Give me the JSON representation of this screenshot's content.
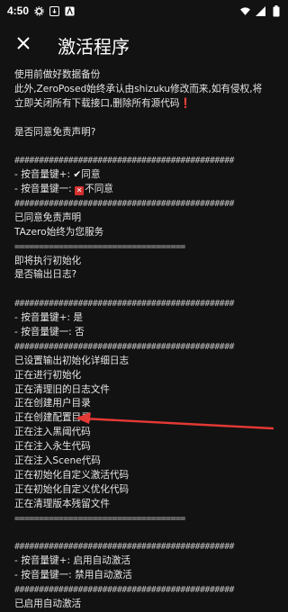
{
  "status_bar": {
    "time": "4:50",
    "left_icons": [
      "settings-icon",
      "download-box-icon",
      "a-box-icon"
    ],
    "right_icons": [
      "wifi-icon",
      "signal-icon",
      "battery-icon"
    ]
  },
  "header": {
    "title": "激活程序",
    "close_icon": "close-icon"
  },
  "log_lines": [
    {
      "text": "使用前做好数据备份"
    },
    {
      "text": "此外,ZeroPosed始终承认由shizuku修改而来,如有侵权,将"
    },
    {
      "text": "立即关闭所有下载接口,删除所有源代码",
      "suffix": "❗"
    },
    {
      "text": ""
    },
    {
      "text": "是否同意免责声明?"
    },
    {
      "text": ""
    },
    {
      "text": "#############################################",
      "sep": true
    },
    {
      "text": "- 按音量键+: ",
      "icon": "check",
      "after": "同意"
    },
    {
      "text": "- 按音量键一: ",
      "icon": "cross",
      "after": "不同意"
    },
    {
      "text": "#############################################",
      "sep": true
    },
    {
      "text": "已同意免责声明"
    },
    {
      "text": "TAzero始终为您服务"
    },
    {
      "text": "===================================",
      "sep": true
    },
    {
      "text": "即将执行初始化"
    },
    {
      "text": "是否输出日志?"
    },
    {
      "text": ""
    },
    {
      "text": "#############################################",
      "sep": true
    },
    {
      "text": "- 按音量键+: 是"
    },
    {
      "text": "- 按音量键一: 否"
    },
    {
      "text": "#############################################",
      "sep": true
    },
    {
      "text": "已设置输出初始化详细日志"
    },
    {
      "text": "正在进行初始化"
    },
    {
      "text": "正在清理旧的日志文件"
    },
    {
      "text": "正在创建用户目录"
    },
    {
      "text": "正在创建配置目录"
    },
    {
      "text": "正在注入黑阈代码"
    },
    {
      "text": "正在注入永生代码"
    },
    {
      "text": "正在注入Scene代码"
    },
    {
      "text": "正在初始化自定义激活代码"
    },
    {
      "text": "正在初始化自定义优化代码"
    },
    {
      "text": "正在清理版本残留文件"
    },
    {
      "text": "===================================",
      "sep": true
    },
    {
      "text": ""
    },
    {
      "text": "#############################################",
      "sep": true
    },
    {
      "text": "- 按音量键+: 启用自动激活"
    },
    {
      "text": "- 按音量键一: 禁用自动激活"
    },
    {
      "text": "#############################################",
      "sep": true
    },
    {
      "text": "已启用自动激活"
    }
  ],
  "colors": {
    "background": "#121212",
    "text": "#e6e6e6",
    "arrow": "#e53935"
  }
}
